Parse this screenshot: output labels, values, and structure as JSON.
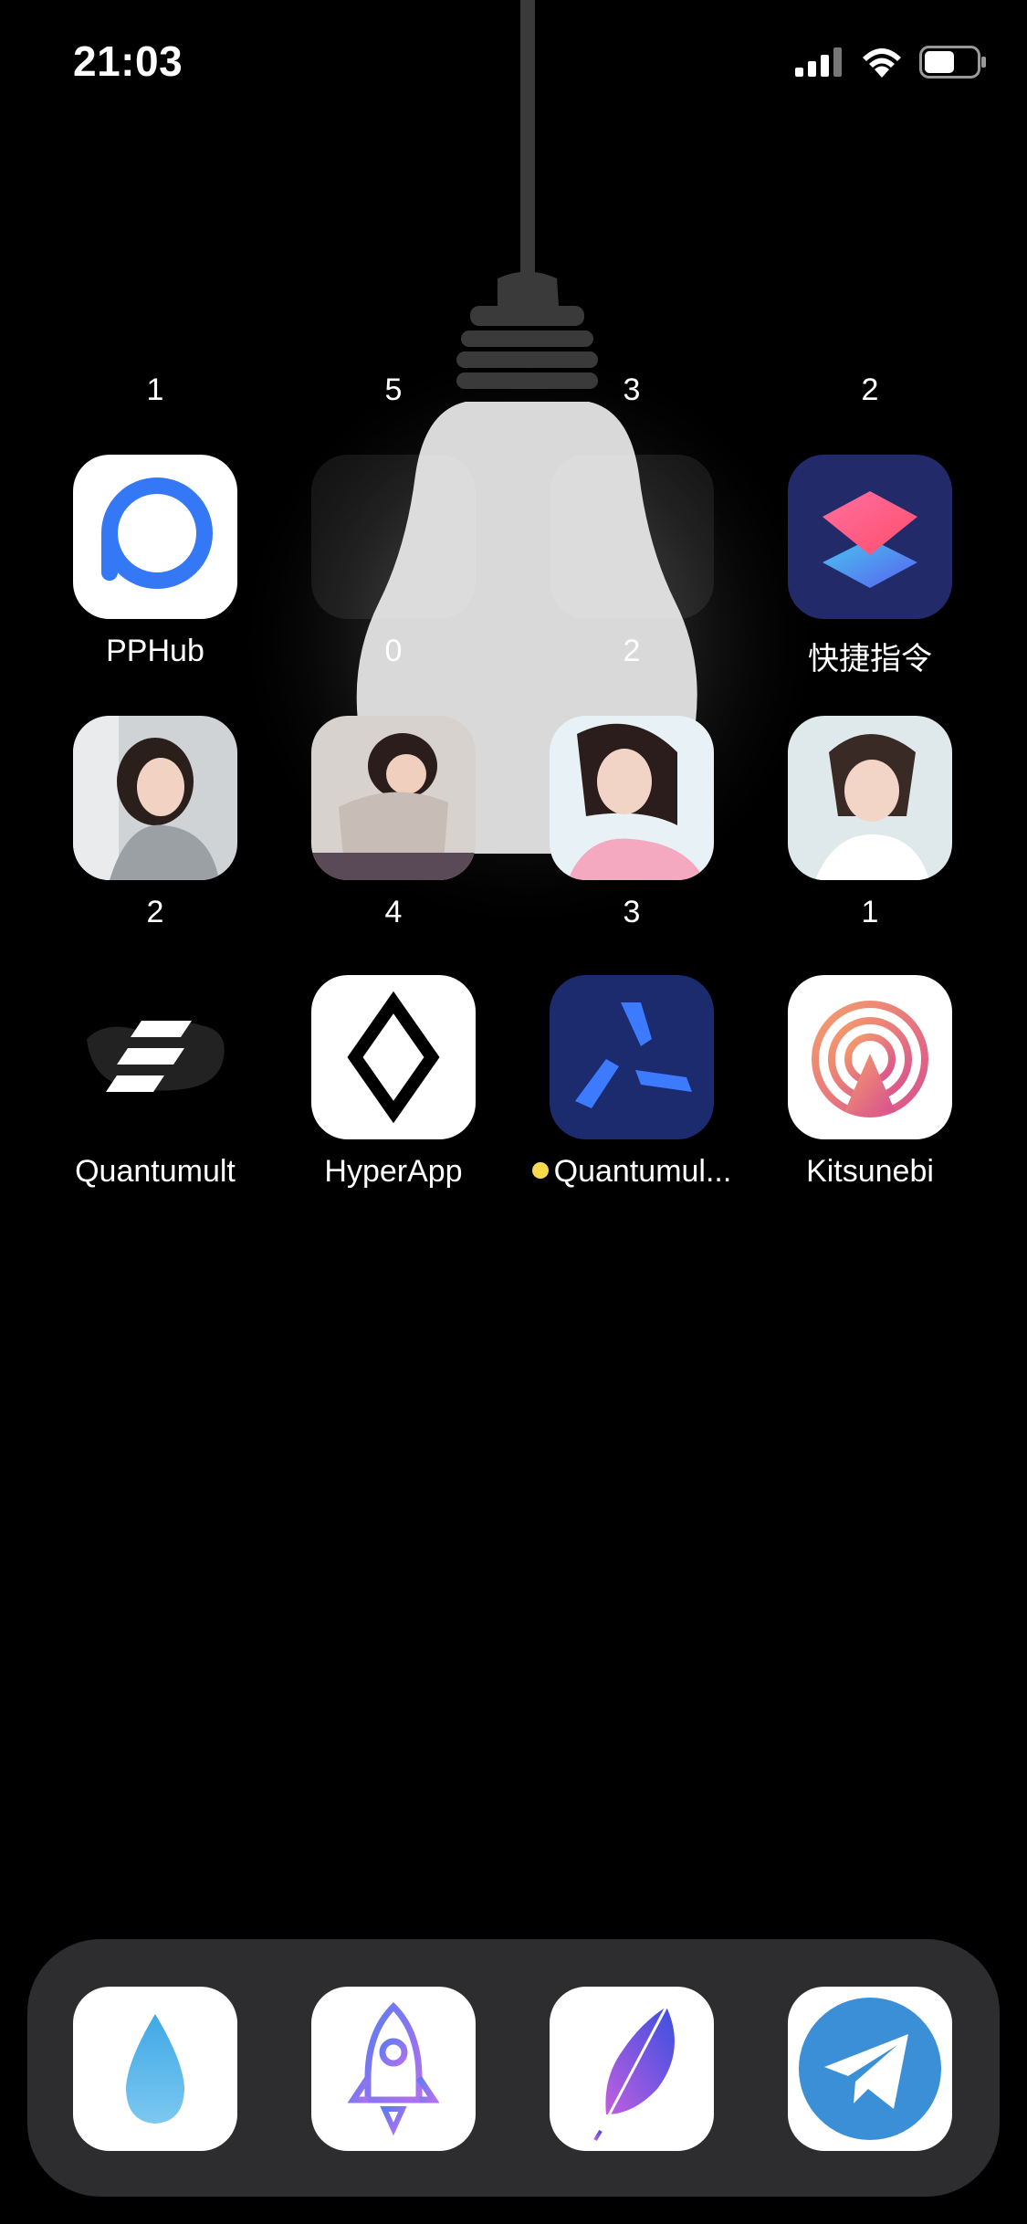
{
  "status_bar": {
    "time": "21:03",
    "icons": [
      "cellular-signal-icon",
      "wifi-icon",
      "battery-icon"
    ]
  },
  "badge_rows": [
    [
      "1",
      "5",
      "3",
      "2"
    ],
    [
      "",
      "0",
      "2",
      ""
    ],
    [
      "2",
      "4",
      "3",
      "1"
    ]
  ],
  "apps_row1": [
    {
      "name": "PPHub",
      "icon": "pphub-icon"
    },
    {
      "name": "",
      "icon": "blank-widget"
    },
    {
      "name": "",
      "icon": "blank-widget"
    },
    {
      "name": "快捷指令",
      "icon": "shortcuts-icon"
    }
  ],
  "apps_row2": [
    {
      "icon": "photo-girl-1"
    },
    {
      "icon": "photo-girl-2"
    },
    {
      "icon": "photo-girl-3"
    },
    {
      "icon": "photo-girl-4"
    }
  ],
  "apps_row3": [
    {
      "name": "Quantumult",
      "icon": "quantumult-icon"
    },
    {
      "name": "HyperApp",
      "icon": "hyperapp-diamond-icon"
    },
    {
      "name": "Quantumul...",
      "icon": "quantumult-x-icon",
      "update_dot": true
    },
    {
      "name": "Kitsunebi",
      "icon": "kitsunebi-icon"
    }
  ],
  "dock": [
    {
      "icon": "water-drop-icon"
    },
    {
      "icon": "rocket-icon"
    },
    {
      "icon": "feather-icon"
    },
    {
      "icon": "telegram-icon"
    }
  ],
  "colors": {
    "background": "#000000",
    "dock": "#3c3c40",
    "pphub_blue": "#3478f6",
    "quantumult_x_blue": "#1c2a6e",
    "update_dot": "#f6d94c",
    "telegram_blue": "#3a8fd6"
  }
}
